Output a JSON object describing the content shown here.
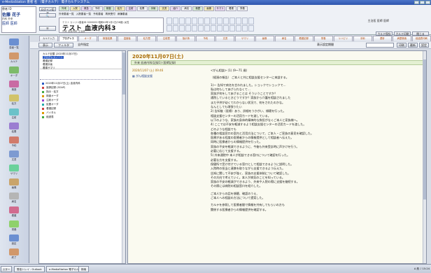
{
  "window": {
    "title": "e-MediaStation  患者 名 （電子カルテ）  電子カルテシステム"
  },
  "hospital": {
    "label": "患者 ID",
    "name": "佐藤 花子",
    "dept": "内科 外来",
    "user": "医師 医師",
    "change_button": "ログイン切替"
  },
  "top_tabs": [
    "外来",
    "入院",
    "救急",
    "予約",
    "検査",
    "処方",
    "注射",
    "処置",
    "手術",
    "文書",
    "紹介",
    "病名",
    "検歴",
    "画像",
    "サマリ",
    "看護",
    "栄養"
  ],
  "top_links": [
    "外来患者一覧",
    "入院患者一覧",
    "予約患者",
    "再来受付",
    "病棟患者"
  ],
  "patient": {
    "kana": "テスト カンジャ",
    "name": "テスト  血液内科3",
    "id_text": "患者ID 0000000  昭和40年1月1日(58歳)  女性",
    "sub": "外来  血液内科  主治医"
  },
  "header_right": {
    "text": "主治医  医師 医師",
    "buttons": [
      "カルテ保存",
      "カルテ印刷",
      "閉じる"
    ]
  },
  "tabs": [
    {
      "label": "カルテ入力",
      "active": false
    },
    {
      "label": "プログレス",
      "active": true
    },
    {
      "label": "オーダ",
      "active": false
    },
    {
      "label": "検査結果",
      "active": false
    },
    {
      "label": "温度板",
      "active": false
    },
    {
      "label": "処方歴",
      "active": false
    },
    {
      "label": "注射歴",
      "active": false
    },
    {
      "label": "指示簿",
      "active": false
    },
    {
      "label": "予約",
      "active": false
    },
    {
      "label": "文書",
      "active": false
    },
    {
      "label": "サマリ",
      "active": false
    },
    {
      "label": "画像",
      "active": false
    },
    {
      "label": "病名",
      "active": false
    },
    {
      "label": "看護記録",
      "active": false
    },
    {
      "label": "栄養",
      "active": false
    },
    {
      "label": "リハビリ",
      "active": false
    },
    {
      "label": "手術",
      "active": false
    },
    {
      "label": "透析",
      "active": false
    },
    {
      "label": "病歴検索",
      "active": false
    },
    {
      "label": "経過表印刷",
      "active": false
    }
  ],
  "sidebar": [
    {
      "label": "患者一覧",
      "color": "#6b8fd1"
    },
    {
      "label": "カルテ",
      "color": "#d1986b"
    },
    {
      "label": "オーダ",
      "color": "#7dbb6a"
    },
    {
      "label": "検査",
      "color": "#c96ba3"
    },
    {
      "label": "処方",
      "color": "#d1c36b"
    },
    {
      "label": "注射",
      "color": "#6bc2c9"
    },
    {
      "label": "処置",
      "color": "#9b7dd1"
    },
    {
      "label": "予約",
      "color": "#d17b6b"
    },
    {
      "label": "文書",
      "color": "#7d9ad1"
    },
    {
      "label": "サマリ",
      "color": "#6bd19b"
    },
    {
      "label": "画像",
      "color": "#c9a46b"
    },
    {
      "label": "病名",
      "color": "#b5b5b5"
    },
    {
      "label": "看護",
      "color": "#d16b8f"
    },
    {
      "label": "栄養",
      "color": "#8fd16b"
    },
    {
      "label": "設定",
      "color": "#6b8fd1"
    },
    {
      "label": "終了",
      "color": "#d1986b"
    }
  ],
  "toolbar": {
    "view": "表示",
    "filter": "フィルタ",
    "current": "全件指定",
    "period_label": "表示設定期間",
    "print": "印刷",
    "refresh": "最新",
    "settings": "設定",
    "help": "ヘルプ"
  },
  "tree": {
    "top_items": [
      "カルテ記載 (2020年11月07日)",
      "プログレスノート",
      "看護記録",
      "看護計画",
      "看護サマリ"
    ],
    "lines": [
      "2020年11月07日(土) 血液内科",
      "  医師記録 (SOAP)",
      "  指示・処方",
      "  検査オーダ",
      "  注射オーダ",
      "  処置オーダ",
      "  看護記録",
      "  バイタル",
      "  経過表"
    ]
  },
  "detail": {
    "date": "2020年11月07日(土)",
    "bar": "外来  血液内科(記録1)  (医師記録)",
    "entry_time": "2020/11/07 (土) 09:46",
    "entry_doc": "がん相談支援",
    "note": [
      "<がん相談>  (1)  (9〜71 歳)",
      "",
      "〔経過の報告〕 ご本人と共に相談支援センターに来談する。",
      "",
      "1)〜  告知で病名を言われました。ショックでショックで…",
      "      私は何もしてあげられなくて…",
      "      家族が何をしてあげることは  そういうことですか？",
      "      通院しているときどうですか？家族から介護を相談されました",
      "      まだ子供が幼くてわからない状況で、何をされたのかな。",
      "      なんとしても頑張りたい",
      "2) 告知後（医療）あり、詳細をうかがい、傾聴を行った。",
      "      相談支援センターの活用カードを渡している。",
      "      以下のような、家族の身体的精神的な負担がなくご本人と家族様へ。",
      "4) ここでは不安を軽減するよう相談支援センターの活用カードを渡した。",
      "      どのような相談でも",
      "      各種の相談窓口の案内と活用方法について、ご本人・ご家族の意見を確認した。",
      "      医療がある程度の医療者からの情報提供として相談者へ伝えた。",
      "      同時に医療者からの情報提供を行った。",
      "      家族の不安を軽減できるように、今後も外来受診時に声かけを行う。",
      "      必要に応じて支援する。",
      "5) 外来通院中  本人が相談できる窓口について確認を行った。",
      "      必要な方を支援する。",
      "      保健所で受け付けている窓口として相談できるように説明した。",
      "      入院時の担当と連携を取りながら支援できるよう伝えた。",
      "      告知に関して不安が強く、家族の支援体制について確認した。",
      "      その方向で考えていく。本人が病気のことを知っている。",
      "      家族の不安の軽減ができるよう、外来や入院の際に支援を継続する。",
      "      その際には病院の相談窓口を紹介した。",
      "",
      "ご本人からの話を傾聴、確認のうえ、",
      "ご本人への相談の方法について提案した。",
      "",
      "カルテを参照して医療者間で情報を共有してもらいの方も",
      "関係する医療者からの情報提供を確認する。"
    ]
  },
  "taskbar": {
    "start": "スタート",
    "items": [
      "受信トレイ - Outlook",
      "e-MediaStation 電子カルテ",
      "検索"
    ],
    "tray": "A 般 ♪  15:24"
  }
}
